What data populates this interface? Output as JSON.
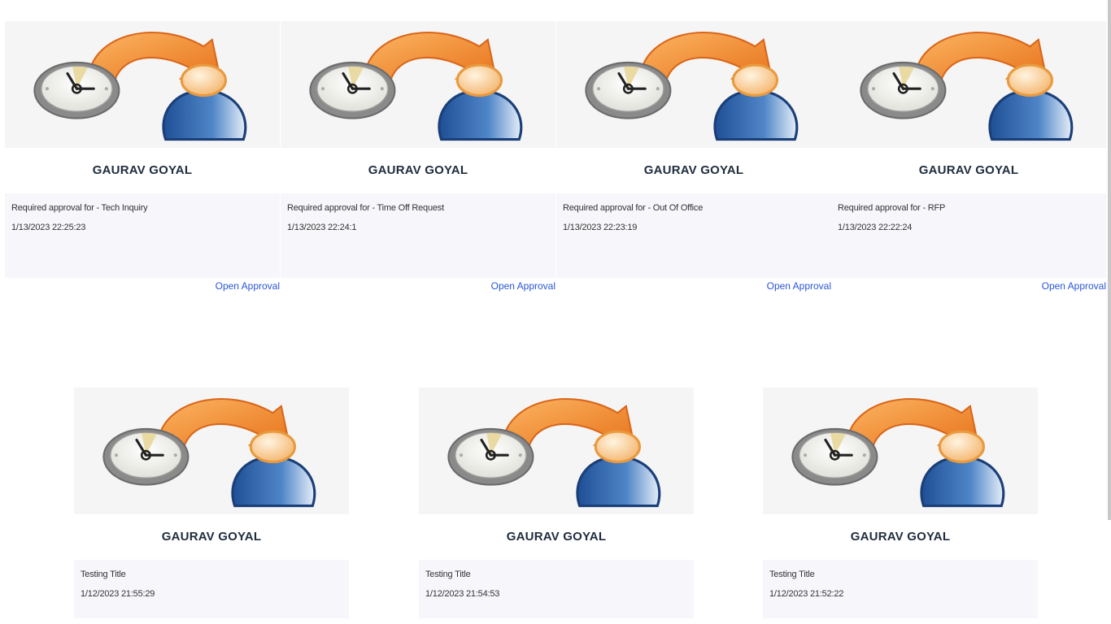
{
  "cards_row1": [
    {
      "name": "GAURAV GOYAL",
      "title": "Required approval for - Tech Inquiry",
      "date": "1/13/2023 22:25:23",
      "link": "Open Approval",
      "icon": "approval-clock-user-icon"
    },
    {
      "name": "GAURAV GOYAL",
      "title": "Required approval for - Time Off Request",
      "date": "1/13/2023 22:24:1",
      "link": "Open Approval",
      "icon": "approval-clock-user-icon"
    },
    {
      "name": "GAURAV GOYAL",
      "title": "Required approval for - Out Of Office",
      "date": "1/13/2023 22:23:19",
      "link": "Open Approval",
      "icon": "approval-clock-user-icon"
    },
    {
      "name": "GAURAV GOYAL",
      "title": "Required approval for - RFP",
      "date": "1/13/2023 22:22:24",
      "link": "Open Approval",
      "icon": "approval-clock-user-icon"
    }
  ],
  "cards_row2": [
    {
      "name": "GAURAV GOYAL",
      "title": "Testing Title",
      "date": "1/12/2023 21:55:29",
      "icon": "approval-clock-user-icon"
    },
    {
      "name": "GAURAV GOYAL",
      "title": "Testing Title",
      "date": "1/12/2023 21:54:53",
      "icon": "approval-clock-user-icon"
    },
    {
      "name": "GAURAV GOYAL",
      "title": "Testing Title",
      "date": "1/12/2023 21:52:22",
      "icon": "approval-clock-user-icon"
    }
  ],
  "colors": {
    "link": "#2a55d8",
    "name": "#1f2d3d",
    "arrow": "#f08a20",
    "user": "#2e62a8"
  }
}
